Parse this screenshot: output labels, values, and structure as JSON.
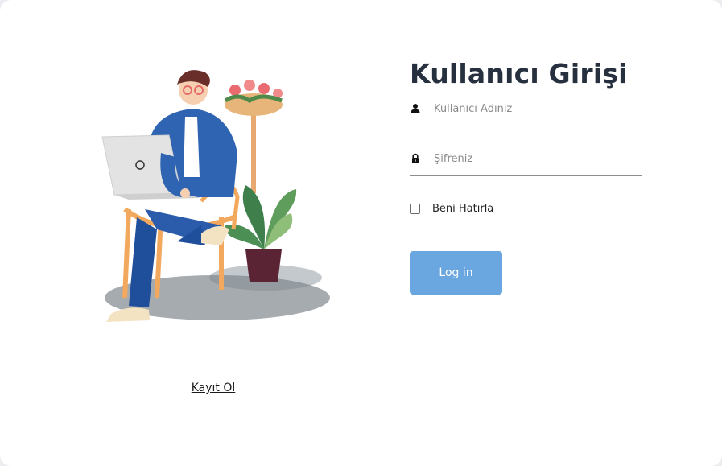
{
  "login": {
    "title": "Kullanıcı Girişi",
    "username_placeholder": "Kullanıcı Adınız",
    "password_placeholder": "Şifreniz",
    "remember_label": "Beni Hatırla",
    "login_button": "Log in"
  },
  "signup": {
    "link_label": "Kayıt Ol"
  },
  "colors": {
    "title": "#27303f",
    "button": "#6aa7e0",
    "field_border": "#8e8e8e"
  },
  "icons": {
    "username": "person-icon",
    "password": "lock-icon"
  }
}
